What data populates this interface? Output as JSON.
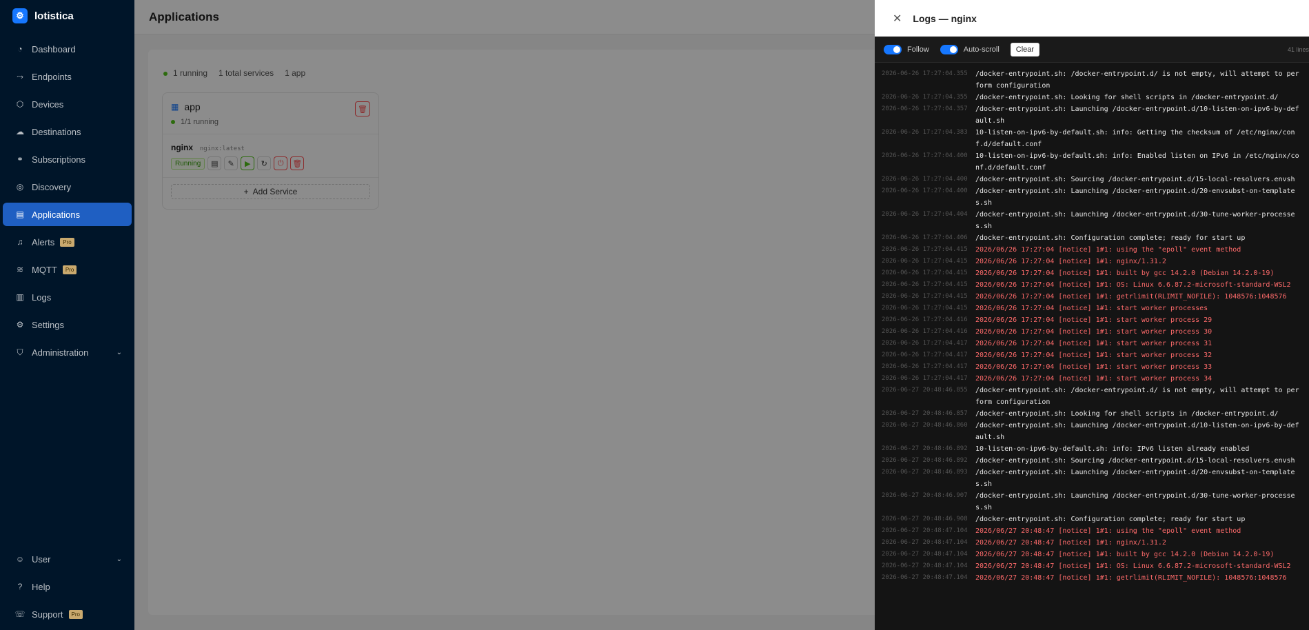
{
  "app": {
    "name": "lotistica"
  },
  "sidebar": {
    "items": [
      {
        "label": "Dashboard",
        "icon": "dashboard-icon"
      },
      {
        "label": "Endpoints",
        "icon": "endpoints-icon"
      },
      {
        "label": "Devices",
        "icon": "devices-icon"
      },
      {
        "label": "Destinations",
        "icon": "destinations-icon"
      },
      {
        "label": "Subscriptions",
        "icon": "subscriptions-icon"
      },
      {
        "label": "Discovery",
        "icon": "discovery-icon"
      },
      {
        "label": "Applications",
        "icon": "applications-icon",
        "active": true
      },
      {
        "label": "Alerts",
        "icon": "bell-icon",
        "badge": "Pro"
      },
      {
        "label": "MQTT",
        "icon": "wifi-icon",
        "badge": "Pro"
      },
      {
        "label": "Logs",
        "icon": "logs-icon"
      },
      {
        "label": "Settings",
        "icon": "gear-icon"
      },
      {
        "label": "Administration",
        "icon": "shield-icon",
        "chevron": true
      }
    ],
    "bottom": [
      {
        "label": "User",
        "icon": "user-icon",
        "chevron": true
      },
      {
        "label": "Help",
        "icon": "help-icon"
      },
      {
        "label": "Support",
        "icon": "support-icon",
        "badge": "Pro"
      }
    ]
  },
  "page": {
    "title": "Applications"
  },
  "stats": {
    "running": "1 running",
    "total_services": "1 total services",
    "apps": "1 app"
  },
  "app_card": {
    "name": "app",
    "running": "1/1 running",
    "service": {
      "name": "nginx",
      "image": "nginx:latest",
      "status": "Running"
    },
    "add_service": "Add Service"
  },
  "drawer": {
    "title": "Logs — nginx",
    "follow": "Follow",
    "autoscroll": "Auto-scroll",
    "clear": "Clear",
    "line_count": "41 lines"
  },
  "logs": [
    {
      "ts": "2026-06-26 17:27:04.355",
      "msg": "/docker-entrypoint.sh: /docker-entrypoint.d/ is not empty, will attempt to perform configuration",
      "notice": false
    },
    {
      "ts": "2026-06-26 17:27:04.355",
      "msg": "/docker-entrypoint.sh: Looking for shell scripts in /docker-entrypoint.d/",
      "notice": false
    },
    {
      "ts": "2026-06-26 17:27:04.357",
      "msg": "/docker-entrypoint.sh: Launching /docker-entrypoint.d/10-listen-on-ipv6-by-default.sh",
      "notice": false
    },
    {
      "ts": "2026-06-26 17:27:04.383",
      "msg": "10-listen-on-ipv6-by-default.sh: info: Getting the checksum of /etc/nginx/conf.d/default.conf",
      "notice": false
    },
    {
      "ts": "2026-06-26 17:27:04.400",
      "msg": "10-listen-on-ipv6-by-default.sh: info: Enabled listen on IPv6 in /etc/nginx/conf.d/default.conf",
      "notice": false
    },
    {
      "ts": "2026-06-26 17:27:04.400",
      "msg": "/docker-entrypoint.sh: Sourcing /docker-entrypoint.d/15-local-resolvers.envsh",
      "notice": false
    },
    {
      "ts": "2026-06-26 17:27:04.400",
      "msg": "/docker-entrypoint.sh: Launching /docker-entrypoint.d/20-envsubst-on-templates.sh",
      "notice": false
    },
    {
      "ts": "2026-06-26 17:27:04.404",
      "msg": "/docker-entrypoint.sh: Launching /docker-entrypoint.d/30-tune-worker-processes.sh",
      "notice": false
    },
    {
      "ts": "2026-06-26 17:27:04.406",
      "msg": "/docker-entrypoint.sh: Configuration complete; ready for start up",
      "notice": false
    },
    {
      "ts": "2026-06-26 17:27:04.415",
      "msg": "2026/06/26 17:27:04 [notice] 1#1: using the \"epoll\" event method",
      "notice": true
    },
    {
      "ts": "2026-06-26 17:27:04.415",
      "msg": "2026/06/26 17:27:04 [notice] 1#1: nginx/1.31.2",
      "notice": true
    },
    {
      "ts": "2026-06-26 17:27:04.415",
      "msg": "2026/06/26 17:27:04 [notice] 1#1: built by gcc 14.2.0 (Debian 14.2.0-19)",
      "notice": true
    },
    {
      "ts": "2026-06-26 17:27:04.415",
      "msg": "2026/06/26 17:27:04 [notice] 1#1: OS: Linux 6.6.87.2-microsoft-standard-WSL2",
      "notice": true
    },
    {
      "ts": "2026-06-26 17:27:04.415",
      "msg": "2026/06/26 17:27:04 [notice] 1#1: getrlimit(RLIMIT_NOFILE): 1048576:1048576",
      "notice": true
    },
    {
      "ts": "2026-06-26 17:27:04.415",
      "msg": "2026/06/26 17:27:04 [notice] 1#1: start worker processes",
      "notice": true
    },
    {
      "ts": "2026-06-26 17:27:04.416",
      "msg": "2026/06/26 17:27:04 [notice] 1#1: start worker process 29",
      "notice": true
    },
    {
      "ts": "2026-06-26 17:27:04.416",
      "msg": "2026/06/26 17:27:04 [notice] 1#1: start worker process 30",
      "notice": true
    },
    {
      "ts": "2026-06-26 17:27:04.417",
      "msg": "2026/06/26 17:27:04 [notice] 1#1: start worker process 31",
      "notice": true
    },
    {
      "ts": "2026-06-26 17:27:04.417",
      "msg": "2026/06/26 17:27:04 [notice] 1#1: start worker process 32",
      "notice": true
    },
    {
      "ts": "2026-06-26 17:27:04.417",
      "msg": "2026/06/26 17:27:04 [notice] 1#1: start worker process 33",
      "notice": true
    },
    {
      "ts": "2026-06-26 17:27:04.417",
      "msg": "2026/06/26 17:27:04 [notice] 1#1: start worker process 34",
      "notice": true
    },
    {
      "ts": "2026-06-27 20:48:46.855",
      "msg": "/docker-entrypoint.sh: /docker-entrypoint.d/ is not empty, will attempt to perform configuration",
      "notice": false
    },
    {
      "ts": "2026-06-27 20:48:46.857",
      "msg": "/docker-entrypoint.sh: Looking for shell scripts in /docker-entrypoint.d/",
      "notice": false
    },
    {
      "ts": "2026-06-27 20:48:46.860",
      "msg": "/docker-entrypoint.sh: Launching /docker-entrypoint.d/10-listen-on-ipv6-by-default.sh",
      "notice": false
    },
    {
      "ts": "2026-06-27 20:48:46.892",
      "msg": "10-listen-on-ipv6-by-default.sh: info: IPv6 listen already enabled",
      "notice": false
    },
    {
      "ts": "2026-06-27 20:48:46.892",
      "msg": "/docker-entrypoint.sh: Sourcing /docker-entrypoint.d/15-local-resolvers.envsh",
      "notice": false
    },
    {
      "ts": "2026-06-27 20:48:46.893",
      "msg": "/docker-entrypoint.sh: Launching /docker-entrypoint.d/20-envsubst-on-templates.sh",
      "notice": false
    },
    {
      "ts": "2026-06-27 20:48:46.907",
      "msg": "/docker-entrypoint.sh: Launching /docker-entrypoint.d/30-tune-worker-processes.sh",
      "notice": false
    },
    {
      "ts": "2026-06-27 20:48:46.908",
      "msg": "/docker-entrypoint.sh: Configuration complete; ready for start up",
      "notice": false
    },
    {
      "ts": "2026-06-27 20:48:47.104",
      "msg": "2026/06/27 20:48:47 [notice] 1#1: using the \"epoll\" event method",
      "notice": true
    },
    {
      "ts": "2026-06-27 20:48:47.104",
      "msg": "2026/06/27 20:48:47 [notice] 1#1: nginx/1.31.2",
      "notice": true
    },
    {
      "ts": "2026-06-27 20:48:47.104",
      "msg": "2026/06/27 20:48:47 [notice] 1#1: built by gcc 14.2.0 (Debian 14.2.0-19)",
      "notice": true
    },
    {
      "ts": "2026-06-27 20:48:47.104",
      "msg": "2026/06/27 20:48:47 [notice] 1#1: OS: Linux 6.6.87.2-microsoft-standard-WSL2",
      "notice": true
    },
    {
      "ts": "2026-06-27 20:48:47.104",
      "msg": "2026/06/27 20:48:47 [notice] 1#1: getrlimit(RLIMIT_NOFILE): 1048576:1048576",
      "notice": true
    }
  ]
}
